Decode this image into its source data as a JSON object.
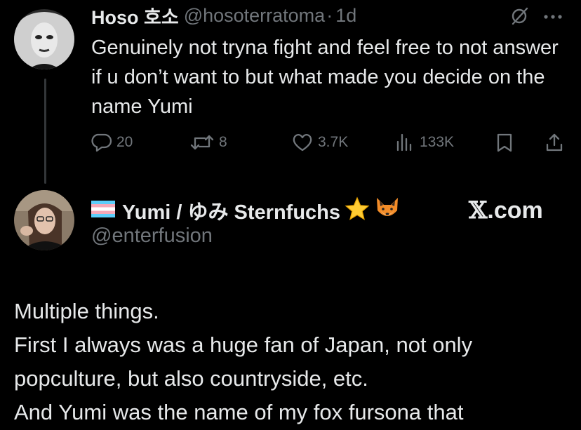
{
  "tweet1": {
    "display_name": "Hoso 호소",
    "handle": "@hosoterratoma",
    "separator": "·",
    "time": "1d",
    "text": "Genuinely not tryna fight and feel free to not answer if u don’t want to but what made you decide on the name Yumi",
    "replies": "20",
    "retweets": "8",
    "likes": "3.7K",
    "views": "133K"
  },
  "tweet2": {
    "display_name": "Yumi / ゆみ Sternfuchs",
    "handle": "@enterfusion",
    "site_label_x": "𝕏",
    "site_label_rest": ".com",
    "body_lines": [
      "Multiple things.",
      "First I always was a huge fan of Japan, not only",
      "popculture, but also countryside, etc.",
      "And Yumi was the name of my fox fursona that"
    ]
  },
  "colors": {
    "background": "#000000",
    "text": "#e7e9ea",
    "muted": "#71767b",
    "thread_line": "#333639"
  },
  "icons": [
    "grok-slash-icon",
    "more-icon",
    "reply-icon",
    "retweet-icon",
    "like-icon",
    "views-icon",
    "bookmark-icon",
    "share-icon",
    "trans-flag-icon",
    "star-emoji-icon",
    "fox-emoji-icon"
  ]
}
